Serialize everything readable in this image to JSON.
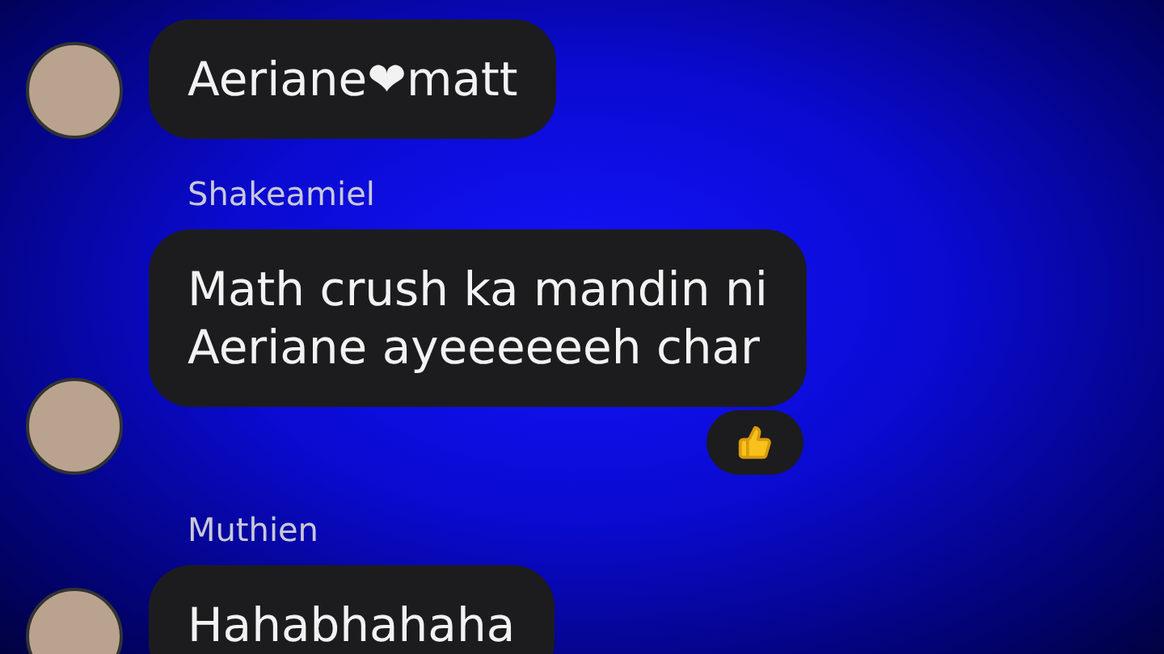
{
  "messages": [
    {
      "text": "Aeriane❤matt"
    },
    {
      "sender": "Shakeamiel",
      "text": "Math crush ka mandin ni\nAeriane ayeeeeeeh char",
      "reaction": {
        "kind": "like"
      }
    },
    {
      "sender": "Muthien",
      "text": "Hahabhahaha"
    }
  ]
}
